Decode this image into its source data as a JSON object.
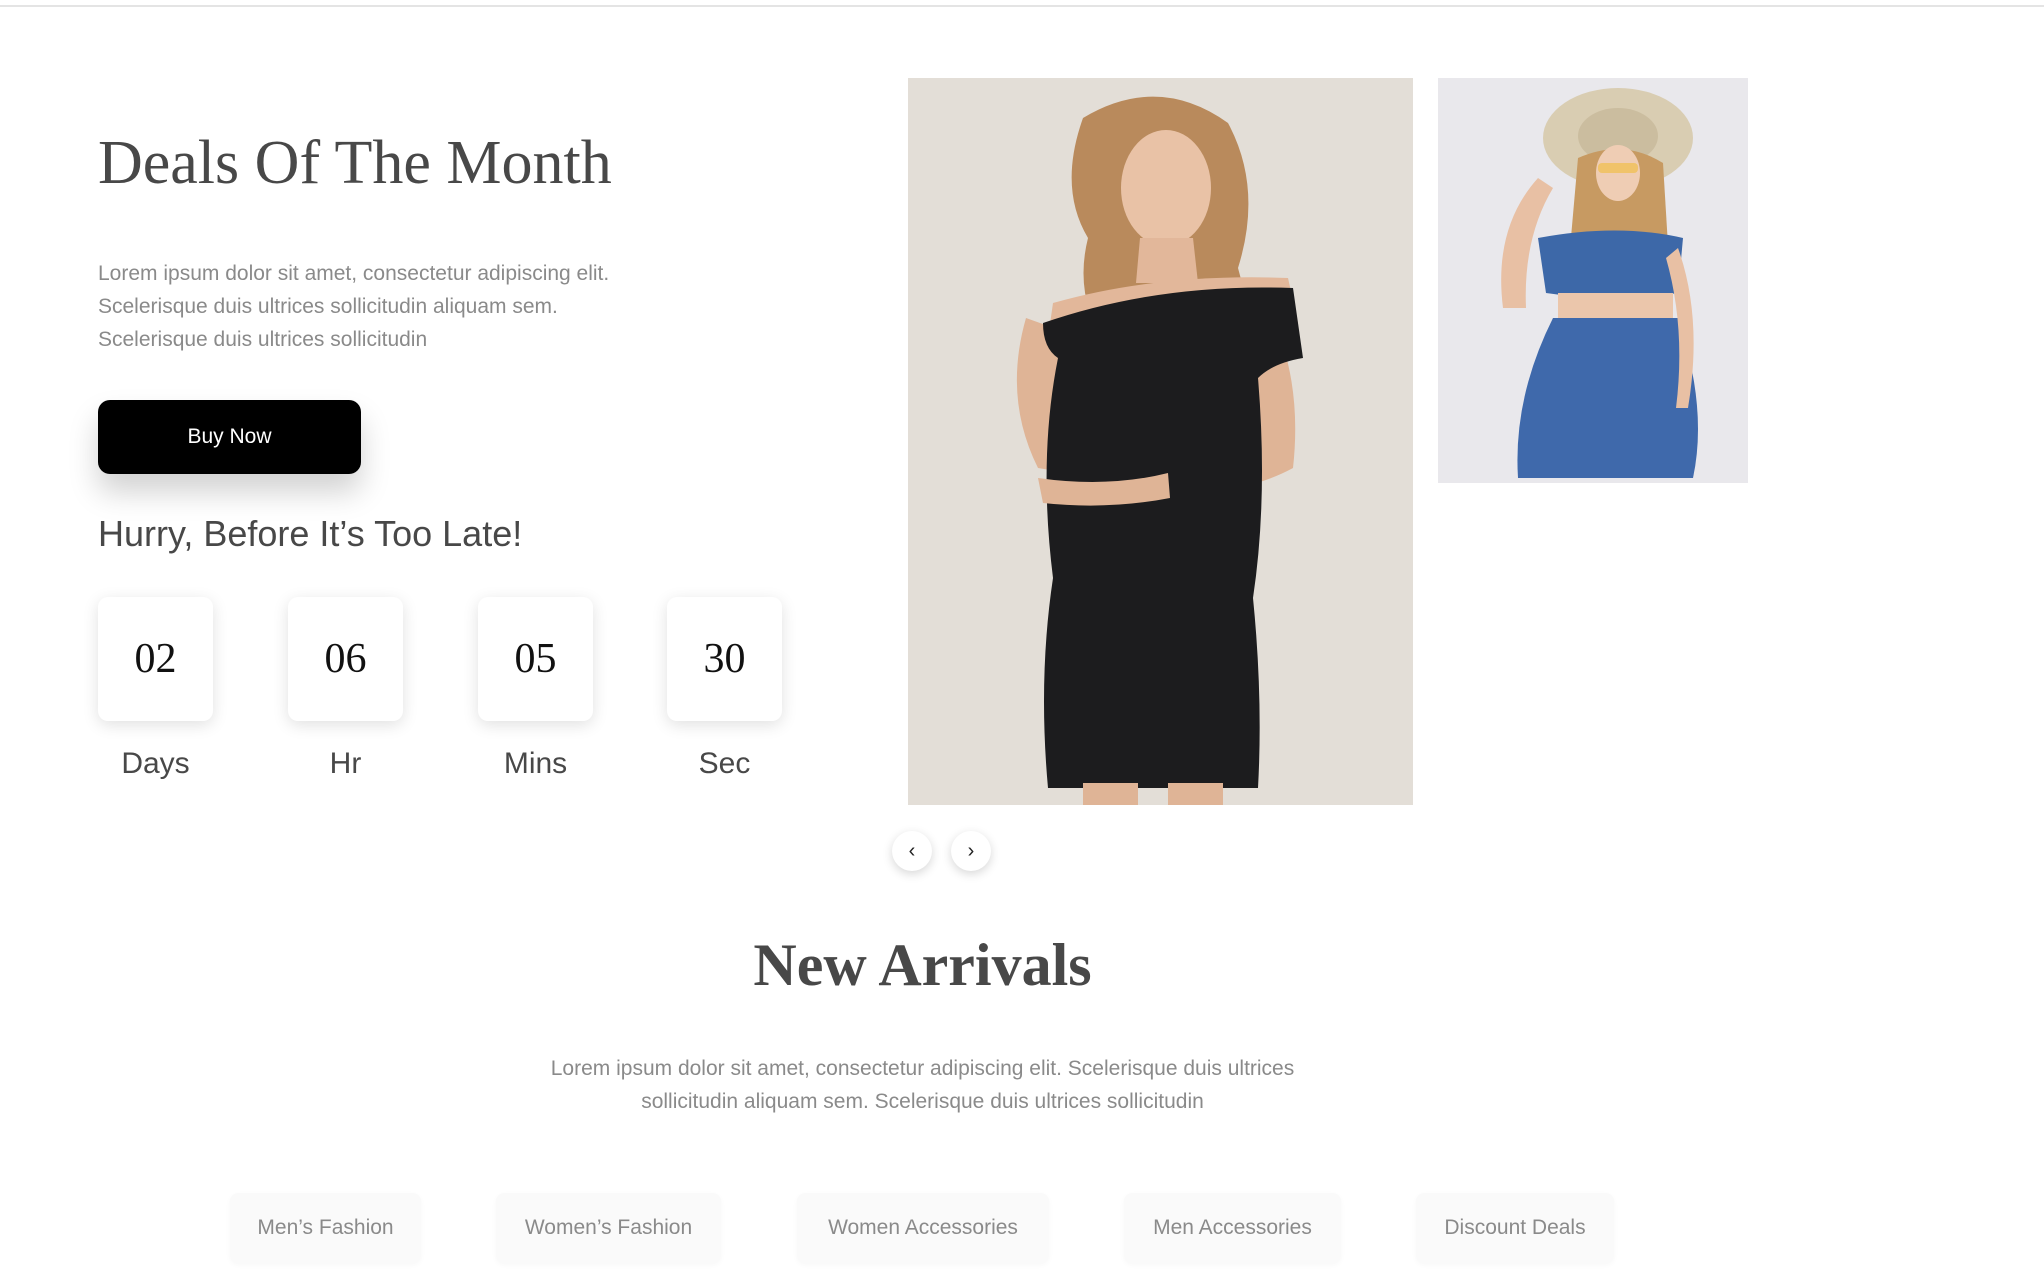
{
  "deals": {
    "title": "Deals Of The Month",
    "description": "Lorem ipsum dolor sit amet, consectetur adipiscing elit. Scelerisque duis ultrices sollicitudin aliquam sem. Scelerisque duis ultrices sollicitudin",
    "buy_label": "Buy Now",
    "hurry_text": "Hurry, Before It’s Too Late!",
    "countdown": [
      {
        "value": "02",
        "label": "Days"
      },
      {
        "value": "06",
        "label": "Hr"
      },
      {
        "value": "05",
        "label": "Mins"
      },
      {
        "value": "30",
        "label": "Sec"
      }
    ]
  },
  "carousel": {
    "prev_icon": "chevron-left-icon",
    "next_icon": "chevron-right-icon",
    "prev_glyph": "‹",
    "next_glyph": "›"
  },
  "new_arrivals": {
    "title": "New Arrivals",
    "description": "Lorem ipsum dolor sit amet, consectetur adipiscing elit. Scelerisque duis ultrices sollicitudin aliquam sem. Scelerisque duis ultrices sollicitudin",
    "categories": [
      "Men’s Fashion",
      "Women’s Fashion",
      "Women Accessories",
      "Men Accessories",
      "Discount Deals"
    ]
  },
  "colors": {
    "button_bg": "#000000",
    "heading": "#484848",
    "muted_text": "#8a8a8a"
  }
}
